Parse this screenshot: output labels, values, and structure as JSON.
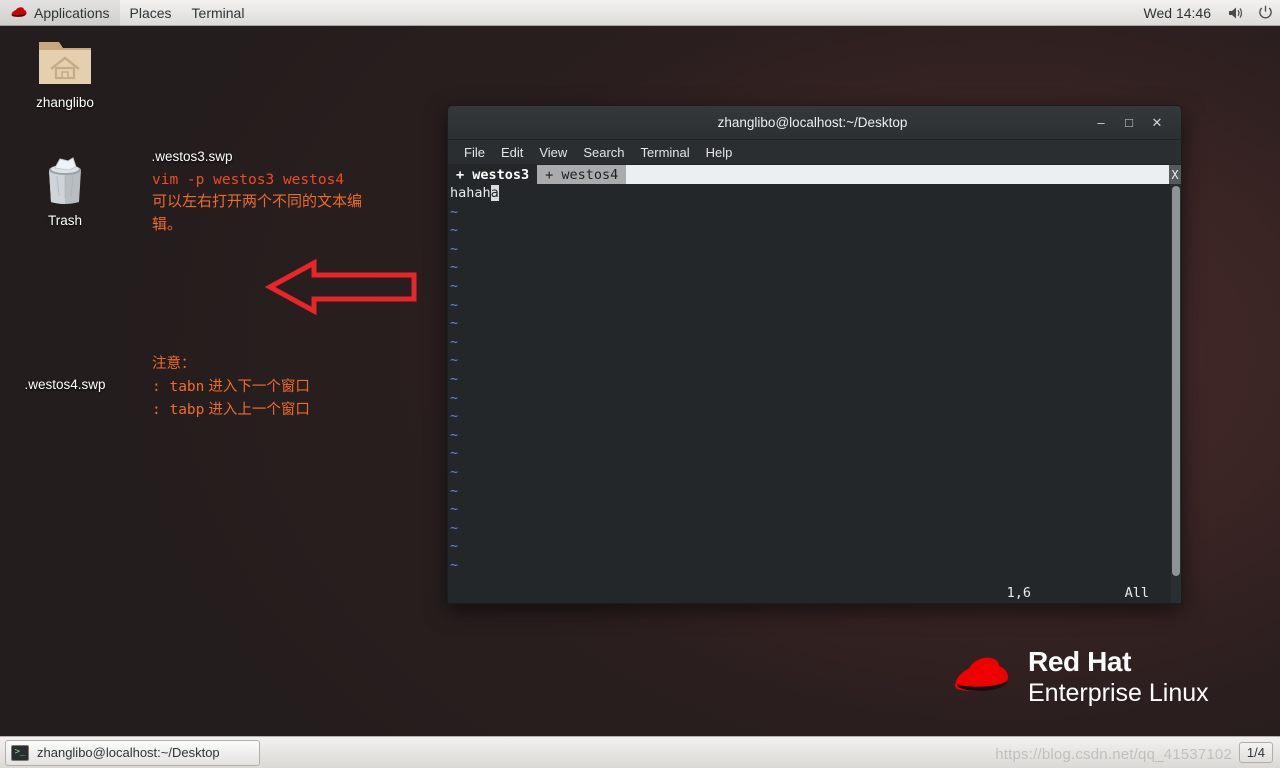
{
  "top_panel": {
    "logo_icon": "redhat-hat-icon",
    "items": [
      {
        "label": "Applications",
        "name": "applications-menu"
      },
      {
        "label": "Places",
        "name": "places-menu"
      },
      {
        "label": "Terminal",
        "name": "terminal-menu"
      }
    ],
    "clock": "Wed 14:46",
    "volume_icon": "volume-icon",
    "power_icon": "power-icon"
  },
  "desktop": {
    "icons": [
      {
        "label": "zhanglibo",
        "icon": "home-folder-icon"
      },
      {
        "label": "Trash",
        "icon": "trash-icon"
      },
      {
        "label": ".westos3.swp",
        "icon": "file-icon"
      },
      {
        "label": ".westos4.swp",
        "icon": "file-icon"
      }
    ]
  },
  "annotations": {
    "command": "vim -p westos3 westos4",
    "chinese_note_1": "可以左右打开两个不同的文本编辑。",
    "note_title": "注意：",
    "note_line_1_cmd": ": tabn",
    "note_line_1_text": "进入下一个窗口",
    "note_line_2_cmd": ": tabp",
    "note_line_2_text": "进入上一个窗口",
    "arrow_color": "#e8252a",
    "text_color": "#ef6b2a"
  },
  "terminal": {
    "title": "zhanglibo@localhost:~/Desktop",
    "window_buttons": {
      "minimize": "–",
      "maximize": "□",
      "close": "✕"
    },
    "menu": [
      "File",
      "Edit",
      "View",
      "Search",
      "Terminal",
      "Help"
    ],
    "vim": {
      "tabs": [
        {
          "label": "+ westos3",
          "active": true
        },
        {
          "label": "+ westos4",
          "active": false
        }
      ],
      "close_label": "X",
      "line_text": "hahah",
      "cursor_char": "a",
      "empty_marker": "~",
      "empty_line_count": 20,
      "ruler": "1,6",
      "percent": "All"
    }
  },
  "branding": {
    "line1": "Red Hat",
    "line2": "Enterprise Linux",
    "hat_color": "#ee0000"
  },
  "bottom_panel": {
    "task_label": "zhanglibo@localhost:~/Desktop",
    "task_icon": "terminal-icon",
    "workspace": "1/4",
    "watermark": "https://blog.csdn.net/qq_41537102"
  }
}
